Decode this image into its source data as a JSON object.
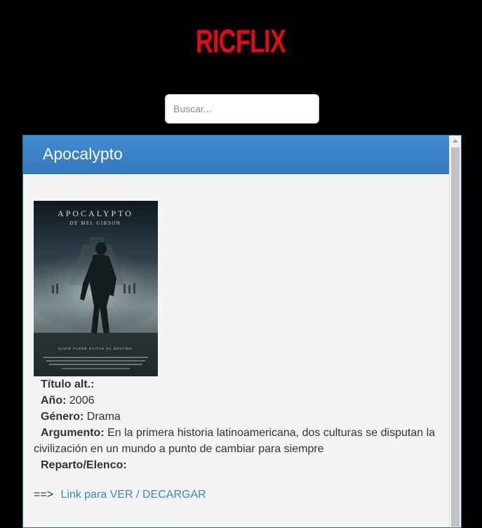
{
  "header": {
    "logo": "RICFLIX",
    "brand_color": "#e50914"
  },
  "search": {
    "placeholder": "Buscar..."
  },
  "movie": {
    "title": "Apocalypto",
    "poster": {
      "title_text": "APOCALYPTO",
      "credit_text": "DE MEL GIBSON",
      "tagline": "NADIE PUEDE EVITAR SU DESTINO"
    },
    "fields": {
      "alt_title_label": "Título alt.:",
      "alt_title_value": "",
      "year_label": "Año:",
      "year_value": "2006",
      "genre_label": "Género:",
      "genre_value": "Drama",
      "plot_label": "Argumento:",
      "plot_value": "En la primera historia latinoamericana, dos culturas se disputan la civilización en un mundo a punto de cambiar para siempre",
      "cast_label": "Reparto/Elenco:",
      "cast_value": ""
    },
    "link_prefix": "==>",
    "link_label": "Link para VER / DECARGAR"
  },
  "colors": {
    "panel_header": "#3579c0",
    "link": "#3a87c8"
  }
}
